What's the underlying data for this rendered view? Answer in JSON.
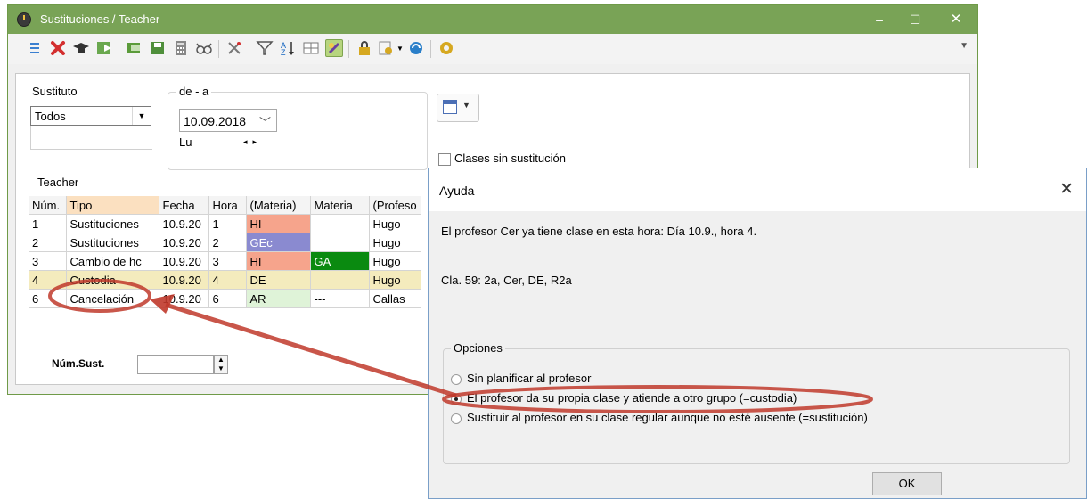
{
  "window": {
    "title": "Sustituciones / Teacher",
    "controls": {
      "minimize": "–",
      "maximize": "☐",
      "close": "✕"
    }
  },
  "toolbar": {
    "icons": [
      "list-icon",
      "delete-icon",
      "teacher-icon",
      "export-icon",
      "import-icon",
      "save-icon",
      "calculator-icon",
      "glasses-icon",
      "tools-icon",
      "filter-icon",
      "sort-icon",
      "grid-icon",
      "edit-icon",
      "lock-icon",
      "settings-dropdown-icon",
      "refresh-icon",
      "gear-icon"
    ]
  },
  "filters": {
    "sustituto_label": "Sustituto",
    "sustituto_value": "Todos",
    "range_label": "de - a",
    "date_value": "10.09.2018",
    "day_label": "Lu",
    "clases_sin_sustitucion_label": "Clases sin sustitución"
  },
  "section_label": "Teacher",
  "table": {
    "headers": [
      "Núm.",
      "Tipo",
      "Fecha",
      "Hora",
      "(Materia)",
      "Materia",
      "(Profeso"
    ],
    "rows": [
      {
        "num": "1",
        "tipo": "Sustituciones",
        "fecha": "10.9.20",
        "hora": "1",
        "materia_orig": "HI",
        "materia": "",
        "profesor": "Hugo"
      },
      {
        "num": "2",
        "tipo": "Sustituciones",
        "fecha": "10.9.20",
        "hora": "2",
        "materia_orig": "GEc",
        "materia": "",
        "profesor": "Hugo"
      },
      {
        "num": "3",
        "tipo": "Cambio de hc",
        "fecha": "10.9.20",
        "hora": "3",
        "materia_orig": "HI",
        "materia": "GA",
        "profesor": "Hugo"
      },
      {
        "num": "4",
        "tipo": "Custodia",
        "fecha": "10.9.20",
        "hora": "4",
        "materia_orig": "DE",
        "materia": "",
        "profesor": "Hugo"
      },
      {
        "num": "6",
        "tipo": "Cancelación",
        "fecha": "10.9.20",
        "hora": "6",
        "materia_orig": "AR",
        "materia": "---",
        "profesor": "Callas"
      }
    ]
  },
  "num_sust_label": "Núm.Sust.",
  "dialog": {
    "title": "Ayuda",
    "close": "✕",
    "message1": "El profesor Cer ya tiene clase en esta hora: Día 10.9., hora 4.",
    "message2": "Cla. 59: 2a, Cer, DE, R2a",
    "options_label": "Opciones",
    "options": [
      "Sin planificar al profesor",
      "El profesor da su propia clase y atiende a otro grupo (=custodia)",
      "Sustituir al profesor en su clase regular aunque no esté ausente (=sustitución)"
    ],
    "selected_option": 1,
    "ok_label": "OK"
  },
  "colors": {
    "titlebar": "#79a356",
    "annotation": "#c0392b",
    "hi": "#f6a48c",
    "gec": "#8a8ad0",
    "ga": "#0a8a10",
    "de": "#f0b78a",
    "ar": "#dff3d8"
  }
}
